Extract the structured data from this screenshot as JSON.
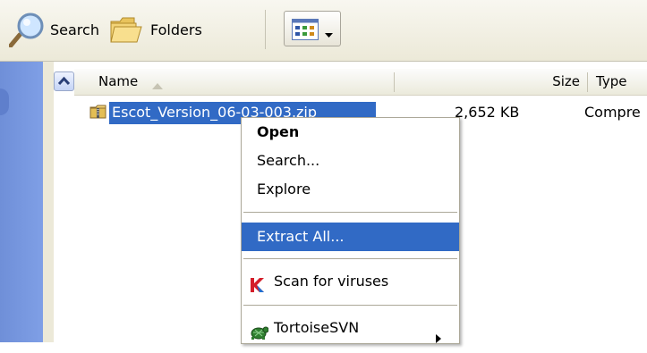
{
  "toolbar": {
    "search_label": "Search",
    "folders_label": "Folders",
    "icons": [
      "search-icon",
      "folder-icon",
      "views-icon",
      "dropdown-arrow-icon"
    ]
  },
  "columns": {
    "name": "Name",
    "size": "Size",
    "type": "Type",
    "sort_icon": "sort-ascending-icon"
  },
  "file": {
    "name": "Escot_Version_06-03-003.zip",
    "size": "2,652 KB",
    "type": "Compre",
    "icon": "zip-folder-icon",
    "selected": true
  },
  "context_menu": {
    "items": [
      {
        "label": "Open",
        "bold": true
      },
      {
        "label": "Search..."
      },
      {
        "label": "Explore"
      },
      {
        "label": "Extract All...",
        "highlighted": true
      },
      {
        "label": "Scan for viruses",
        "icon": "kaspersky-icon"
      },
      {
        "label": "TortoiseSVN",
        "icon": "tortoisesvn-icon",
        "submenu": true
      }
    ]
  },
  "colors": {
    "selection": "#316ac5",
    "toolbar_bg": "#ece9d8",
    "left_pane": "#7393de"
  }
}
